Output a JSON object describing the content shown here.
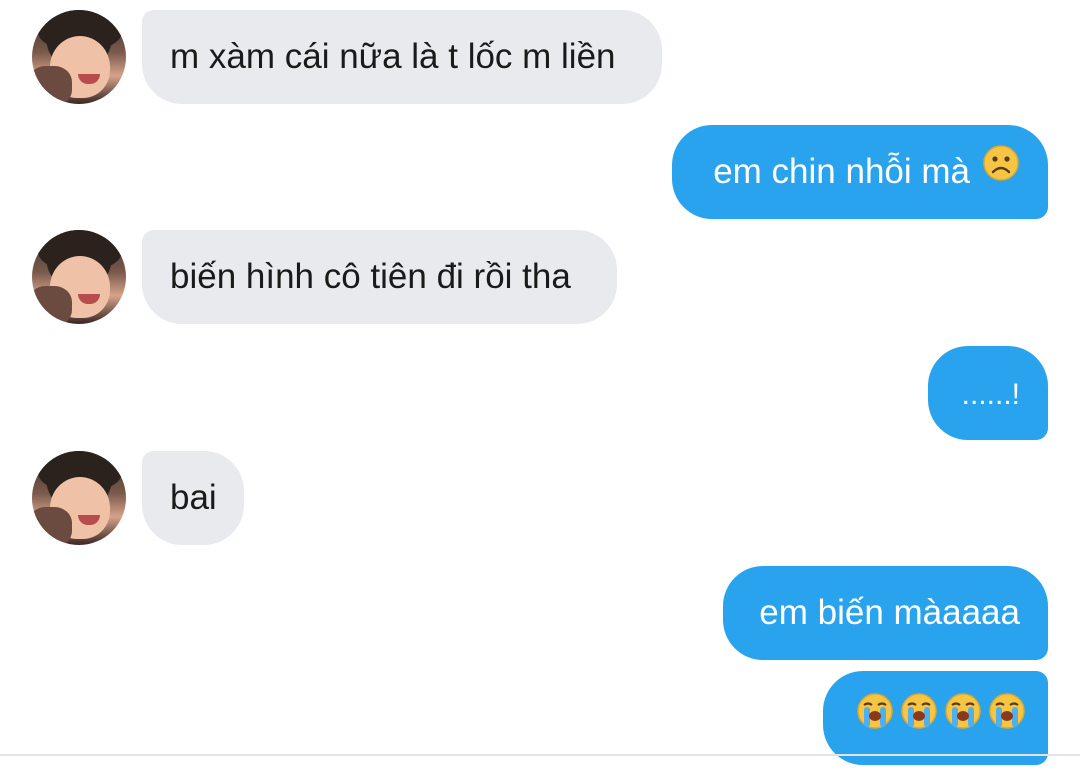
{
  "messages": [
    {
      "from": "them",
      "text": "m xàm cái nữa là t lốc m liền"
    },
    {
      "from": "me",
      "text": "em chin nhỗi mà",
      "emoji": "frowning-face-icon"
    },
    {
      "from": "them",
      "text": "biến hình cô tiên đi rồi tha"
    },
    {
      "from": "me",
      "text": "......!"
    },
    {
      "from": "them",
      "text": "bai"
    },
    {
      "from": "me",
      "text": "em biến màaaaa"
    },
    {
      "from": "me",
      "text": "",
      "emoji": "loudly-crying-face-icon"
    }
  ],
  "colors": {
    "incoming_bubble": "#e8eaed",
    "outgoing_bubble": "#2aa3ef",
    "incoming_text": "#1a1a1a",
    "outgoing_text": "#ffffff"
  }
}
